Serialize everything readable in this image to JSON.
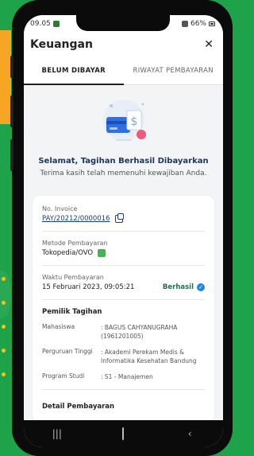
{
  "status_bar": {
    "time": "09.05",
    "battery": "66%"
  },
  "app": {
    "title": "Keuangan"
  },
  "tabs": [
    {
      "label": "BELUM DIBAYAR",
      "active": true
    },
    {
      "label": "RIWAYAT PEMBAYARAN",
      "active": false
    }
  ],
  "success": {
    "title": "Selamat, Tagihan Berhasil Dibayarkan",
    "subtitle": "Terima kasih telah memenuhi kewajiban Anda."
  },
  "invoice": {
    "label": "No. Invoice",
    "number": "PAY/20212/0000016",
    "method_label": "Metode Pembayaran",
    "method": "Tokopedia/OVO",
    "time_label": "Waktu Pembayaran",
    "time": "15 Februari 2023, 09:05:21",
    "status": "Berhasil"
  },
  "pemilik": {
    "title": "Pemilik Tagihan",
    "rows": [
      {
        "key": "Mahasiswa",
        "value": ": BAGUS CAHYANUGRAHA (1961201005)"
      },
      {
        "key": "Perguruan Tinggi",
        "value": ": Akademi Perekam Medis & Informatika Kesehatan Bandung"
      },
      {
        "key": "Program Studi",
        "value": ": S1 - Manajemen"
      }
    ]
  },
  "detail": {
    "title": "Detail Pembayaran"
  },
  "colors": {
    "accent": "#1a3c8c",
    "success": "#2d6a4f",
    "background": "#1fa34a"
  }
}
